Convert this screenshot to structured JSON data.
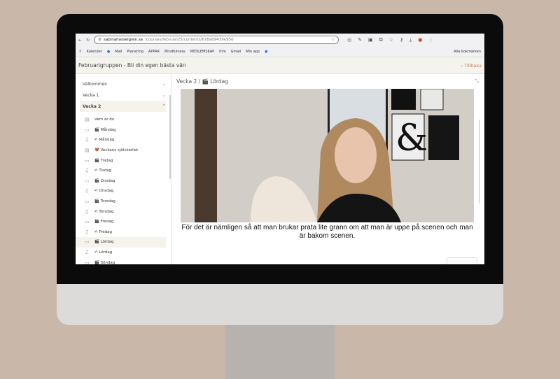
{
  "browser": {
    "url_domain": "sabinahasselgren.se",
    "url_path": "/courses/februari25/contents/678ab9439e950",
    "bookmarks": [
      "Kalender",
      "Mail",
      "Planering",
      "APPAR",
      "Mindfulness",
      "MEDLEMSKAP",
      "Info",
      "Gmail",
      "Min app"
    ],
    "all_bookmarks": "Alla bokmärken"
  },
  "header": {
    "title": "Februarigruppen - Bli din egen bästa vän",
    "back": "Tillbaka"
  },
  "sidebar": {
    "sections": [
      "Välkommen",
      "Vecka 1",
      "Vecka 2"
    ],
    "items": [
      {
        "icon": "doc",
        "label": "Vem är du"
      },
      {
        "icon": "folder",
        "label": "🎬 Måndag"
      },
      {
        "icon": "headphones",
        "label": "✍ Måndag"
      },
      {
        "icon": "doc",
        "label": "🤎 Veckans självkärlek"
      },
      {
        "icon": "folder",
        "label": "🎬 Tisdag"
      },
      {
        "icon": "headphones",
        "label": "✍ Tisdag"
      },
      {
        "icon": "folder",
        "label": "🎬 Onsdag"
      },
      {
        "icon": "headphones",
        "label": "✍ Onsdag"
      },
      {
        "icon": "folder",
        "label": "🎬 Torsdag"
      },
      {
        "icon": "headphones",
        "label": "✍ Torsdag"
      },
      {
        "icon": "folder",
        "label": "🎬 Fredag"
      },
      {
        "icon": "headphones",
        "label": "✍ Fredag"
      },
      {
        "icon": "folder",
        "label": "🎬 Lördag"
      },
      {
        "icon": "headphones",
        "label": "✍ Lördag"
      },
      {
        "icon": "folder",
        "label": "🎬 Söndag"
      }
    ]
  },
  "main": {
    "crumb_parent": "Vecka 2 /",
    "crumb_current": "🎬 Lördag",
    "subtitle": "För det är nämligen så att man brukar prata lite grann om att man är uppe på scenen och man är bakom scenen."
  }
}
